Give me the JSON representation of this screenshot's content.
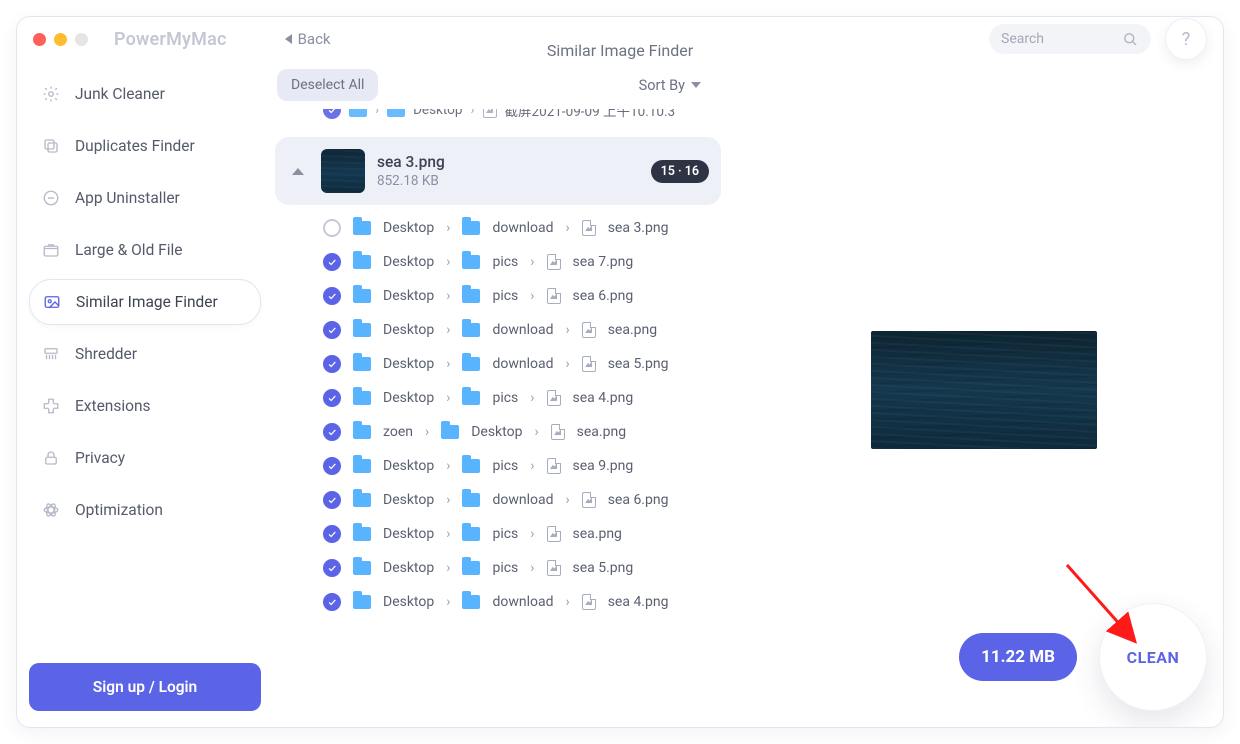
{
  "titlebar": {
    "brand": "PowerMyMac",
    "back_label": "Back",
    "title": "Similar Image Finder",
    "search_placeholder": "Search",
    "help_glyph": "?"
  },
  "sidebar": {
    "items": [
      {
        "label": "Junk Cleaner"
      },
      {
        "label": "Duplicates Finder"
      },
      {
        "label": "App Uninstaller"
      },
      {
        "label": "Large & Old File"
      },
      {
        "label": "Similar Image Finder"
      },
      {
        "label": "Shredder"
      },
      {
        "label": "Extensions"
      },
      {
        "label": "Privacy"
      },
      {
        "label": "Optimization"
      }
    ],
    "active_index": 4,
    "login_label": "Sign up / Login"
  },
  "toolbar": {
    "deselect_label": "Deselect All",
    "sortby_label": "Sort By"
  },
  "partial_row": {
    "checked": true,
    "segments": [
      "Desktop",
      "截屏2021-09-09 上午10.10.3"
    ]
  },
  "group": {
    "name": "sea 3.png",
    "size": "852.18 KB",
    "badge": "15 · 16",
    "collapsed": false
  },
  "rows": [
    {
      "checked": false,
      "path": [
        "Desktop",
        "download",
        "sea 3.png"
      ]
    },
    {
      "checked": true,
      "path": [
        "Desktop",
        "pics",
        "sea 7.png"
      ]
    },
    {
      "checked": true,
      "path": [
        "Desktop",
        "pics",
        "sea 6.png"
      ]
    },
    {
      "checked": true,
      "path": [
        "Desktop",
        "download",
        "sea.png"
      ]
    },
    {
      "checked": true,
      "path": [
        "Desktop",
        "download",
        "sea 5.png"
      ]
    },
    {
      "checked": true,
      "path": [
        "Desktop",
        "pics",
        "sea 4.png"
      ]
    },
    {
      "checked": true,
      "path": [
        "zoen",
        "Desktop",
        "sea.png"
      ]
    },
    {
      "checked": true,
      "path": [
        "Desktop",
        "pics",
        "sea 9.png"
      ]
    },
    {
      "checked": true,
      "path": [
        "Desktop",
        "download",
        "sea 6.png"
      ]
    },
    {
      "checked": true,
      "path": [
        "Desktop",
        "pics",
        "sea.png"
      ]
    },
    {
      "checked": true,
      "path": [
        "Desktop",
        "pics",
        "sea 5.png"
      ]
    },
    {
      "checked": true,
      "path": [
        "Desktop",
        "download",
        "sea 4.png"
      ]
    }
  ],
  "actions": {
    "total_size": "11.22 MB",
    "clean_label": "CLEAN"
  }
}
